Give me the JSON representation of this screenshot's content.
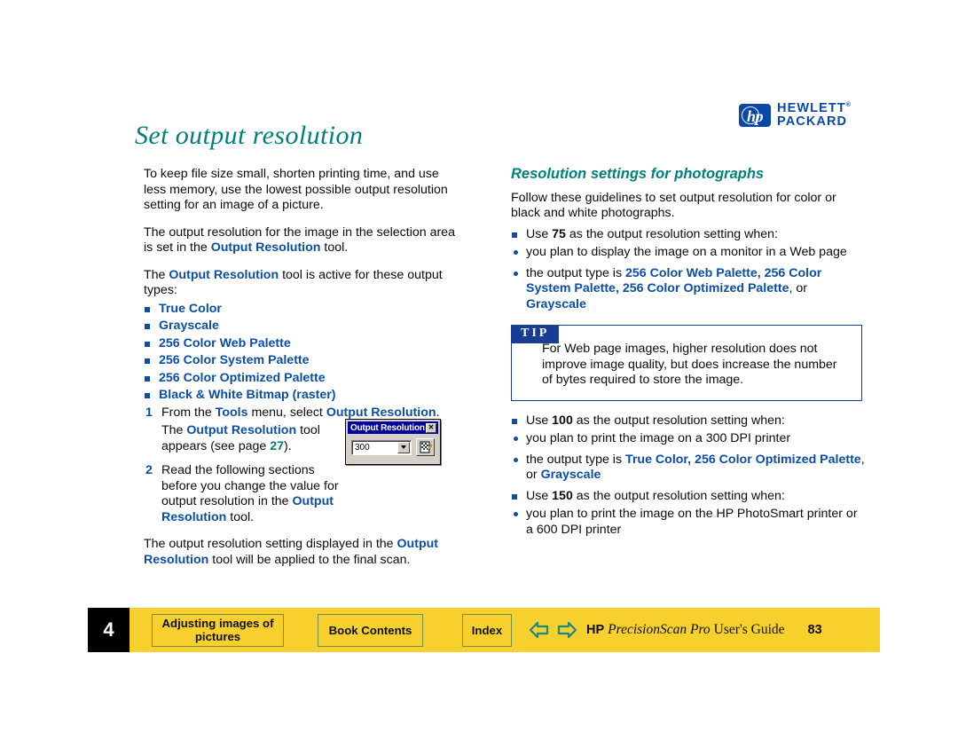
{
  "brand": {
    "logo_letters": "hp",
    "line1": "HEWLETT",
    "line2": "PACKARD",
    "tm": "®"
  },
  "page_title": "Set output resolution",
  "left_column": {
    "para1": "To keep file size small, shorten printing time, and use less memory, use the lowest possible output resolution setting for an image of a picture.",
    "para2_a": "The output resolution for the image in the selection area is set in the ",
    "para2_link": "Output Resolution",
    "para2_b": " tool.",
    "para3_a": "The ",
    "para3_link": "Output Resolution",
    "para3_b": " tool is active for these output types:",
    "output_types": [
      "True Color",
      "Grayscale",
      "256 Color Web Palette",
      "256 Color System Palette",
      "256 Color Optimized Palette",
      "Black & White Bitmap (raster)"
    ],
    "step1": {
      "number": "1",
      "a": "From the ",
      "link1": "Tools",
      "b": " menu, select ",
      "link2": "Output Resolution",
      "c": "."
    },
    "step1_body": {
      "a": "The ",
      "link": "Output Resolution",
      "b": " tool appears (see page ",
      "xref": "27",
      "c": ")."
    },
    "step2": {
      "number": "2",
      "a": "Read the following sections before you change the value for output resolution in the ",
      "link": "Output Resolution",
      "b": " tool."
    },
    "para_final_a": "The output resolution setting displayed in the ",
    "para_final_link": "Output Resolution",
    "para_final_b": " tool will be applied to the final scan."
  },
  "dialog": {
    "title": "Output Resolution",
    "close_label": "✕",
    "value": "300",
    "icon_name": "resolution-tool-icon"
  },
  "right_column": {
    "heading": "Resolution settings for photographs",
    "intro": "Follow these guidelines to set output resolution for color or black and white photographs.",
    "item75": {
      "a": "Use ",
      "value": "75",
      "b": " as the output resolution setting when:"
    },
    "item75_subs": {
      "sub1": "you plan to display the image on a monitor in a Web page",
      "sub2_a": "the output type is ",
      "sub2_link1": "256 Color Web Palette",
      "sub2_sep1": ", ",
      "sub2_link2": "256 Color System Palette",
      "sub2_sep2": ", ",
      "sub2_link3": "256 Color Optimized Palette",
      "sub2_sep3": ", or ",
      "sub2_link4": "Grayscale"
    },
    "tip": {
      "label": "TIP",
      "body": "For Web page images, higher resolution does not improve image quality, but does increase the number of bytes required to store the image."
    },
    "item100": {
      "a": "Use ",
      "value": "100",
      "b": " as the output resolution setting when:"
    },
    "item100_subs": {
      "sub1": "you plan to print the image on a 300 DPI printer",
      "sub2_a": "the output type is ",
      "sub2_link1": "True Color",
      "sub2_sep1": ", ",
      "sub2_link2": "256 Color Optimized Palette",
      "sub2_sep2": ", or ",
      "sub2_link3": "Grayscale"
    },
    "item150": {
      "a": "Use ",
      "value": "150",
      "b": " as the output resolution setting when:"
    },
    "item150_subs": {
      "sub1": "you plan to print the image on the HP PhotoSmart printer or a 600 DPI printer"
    }
  },
  "footer": {
    "chapter_number": "4",
    "chapter_title": "Adjusting images of pictures",
    "book_contents": "Book Contents",
    "index": "Index",
    "back_arrow": "back-arrow-icon",
    "forward_arrow": "forward-arrow-icon",
    "guide_hp": "HP",
    "guide_product": "PrecisionScan Pro",
    "guide_suffix": "User's Guide",
    "page_number": "83"
  },
  "colors": {
    "title_teal": "#00807a",
    "link_blue": "#0b4ea2",
    "tip_blue": "#1a3d94",
    "footer_yellow": "#f7d02e",
    "arrow_teal": "#1a8a86",
    "hp_blue": "#0a48a8"
  }
}
